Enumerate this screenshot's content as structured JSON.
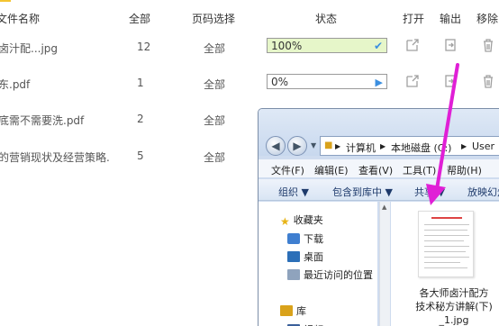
{
  "header": {
    "file_name": "文件名称",
    "all_count": "全部",
    "page_select": "页码选择",
    "status": "状态",
    "open": "打开",
    "output": "输出",
    "remove": "移除"
  },
  "rows": [
    {
      "name": "卤汁配...jpg",
      "count": "12",
      "pages": "全部",
      "progress": "100%",
      "status_icon": "check-icon"
    },
    {
      "name": "东.pdf",
      "count": "1",
      "pages": "全部",
      "progress": "0%",
      "status_icon": "play-icon"
    },
    {
      "name": "底需不需要洗.pdf",
      "count": "2",
      "pages": "全部"
    },
    {
      "name": "的营销现状及经营策略.",
      "count": "5",
      "pages": "全部"
    }
  ],
  "explorer": {
    "breadcrumb": [
      "计算机",
      "本地磁盘 (C:)",
      "User"
    ],
    "menu": [
      "文件(F)",
      "编辑(E)",
      "查看(V)",
      "工具(T)",
      "帮助(H)"
    ],
    "toolbar": [
      "组织 ▼",
      "包含到库中 ▼",
      "共享 ▼",
      "放映幻灯"
    ],
    "nav": {
      "favorites": "收藏夹",
      "downloads": "下载",
      "desktop": "桌面",
      "recent": "最近访问的位置",
      "library": "库",
      "video": "视频"
    },
    "file": {
      "line1": "各大师卤汁配方",
      "line2": "技术秘方讲解(下)",
      "line3": "_1.jpg"
    }
  },
  "colors": {
    "progress_complete": "#e6f6c9",
    "progress_icon": "#3b8fe0",
    "arrow": "#e01fd6"
  }
}
